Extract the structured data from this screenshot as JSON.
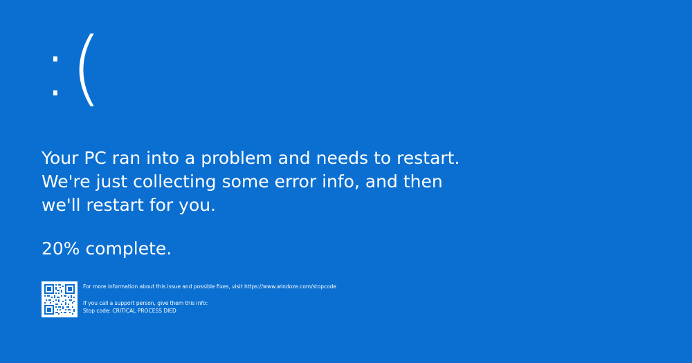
{
  "screen": {
    "background_color": "#0a6fd1",
    "text_color": "#ffffff",
    "sad_face": ":(",
    "message": "Your PC ran into a problem and needs to restart. We're just collecting some error info, and then we'll restart for you.",
    "progress_text": "20% complete.",
    "progress_percent": 20,
    "qr_icon": "qr-code-icon",
    "info": {
      "more_info": "For more information about this issue and possible fixes, visit https://www.windoze.com/stopcode",
      "support_prompt": "If you call a support person, give them this info:",
      "stop_code": "Stop code: CRITICAL PROCESS DIED"
    }
  }
}
